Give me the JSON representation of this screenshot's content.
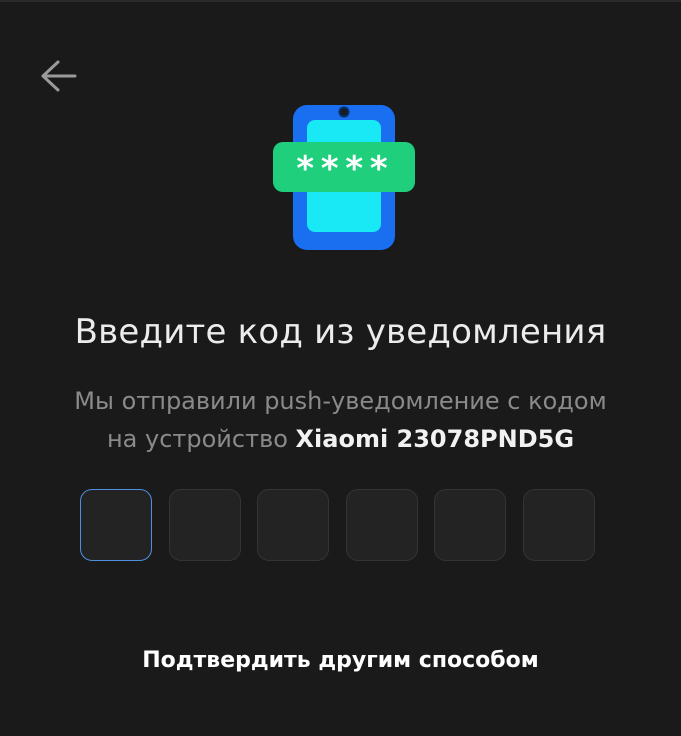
{
  "header": {
    "back_icon": "arrow-left-icon"
  },
  "illustration": {
    "icon": "phone-code-icon",
    "code_mask": "****"
  },
  "title": "Введите код из уведомления",
  "subtitle": {
    "line1": "Мы отправили push-уведомление с кодом",
    "line2_prefix": "на устройство ",
    "device_name": "Xiaomi 23078PND5G"
  },
  "code_input": {
    "length": 6,
    "values": [
      "",
      "",
      "",
      "",
      "",
      ""
    ]
  },
  "alt_link": "Подтвердить другим способом",
  "colors": {
    "background": "#1a1a1a",
    "phone_body": "#1a6ff0",
    "phone_screen": "#19e8f5",
    "code_badge": "#1fcf7c",
    "active_border": "#4e8fe0"
  }
}
